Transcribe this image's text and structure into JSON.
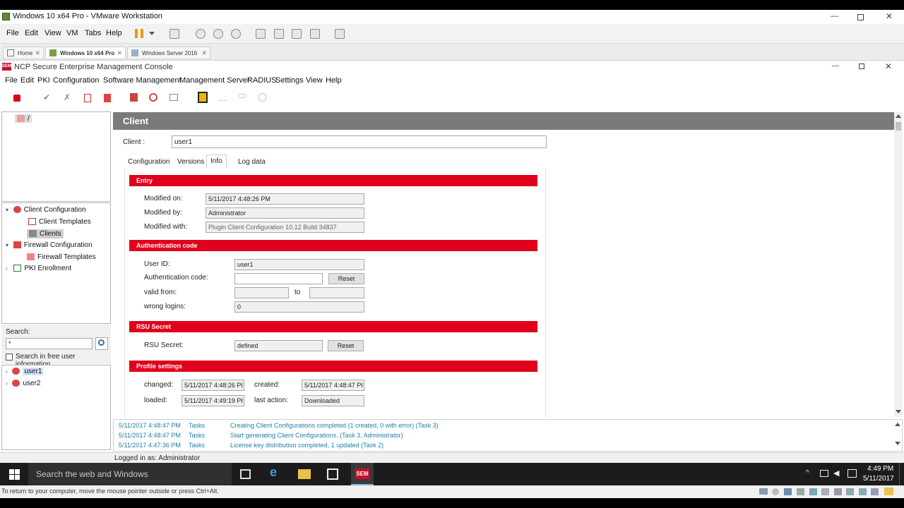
{
  "vmware": {
    "title": "Windows 10 x64 Pro - VMware Workstation",
    "menu": [
      "File",
      "Edit",
      "View",
      "VM",
      "Tabs",
      "Help"
    ],
    "tabs": [
      {
        "label": "Home"
      },
      {
        "label": "Windows 10 x64 Pro"
      },
      {
        "label": "Windows Server 2016"
      }
    ],
    "status_hint": "To return to your computer, move the mouse pointer outside or press Ctrl+Alt."
  },
  "app": {
    "badge": "SEM",
    "title": "NCP Secure Enterprise Management Console",
    "menu": [
      "File",
      "Edit",
      "PKI",
      "Configuration",
      "Software Management",
      "Management Server",
      "RADIUS",
      "Settings",
      "View",
      "Help"
    ],
    "root_node": "/",
    "tree": [
      {
        "label": "Client Configuration"
      },
      {
        "label": "Client Templates"
      },
      {
        "label": "Clients"
      },
      {
        "label": "Firewall Configuration"
      },
      {
        "label": "Firewall Templates"
      },
      {
        "label": "PKI Enrollment"
      }
    ],
    "search": {
      "label": "Search:",
      "value": "*",
      "free_user_info_label": "Search in free user information"
    },
    "users": [
      "user1",
      "user2"
    ],
    "status": "Logged in as: Administrator"
  },
  "client_panel": {
    "header": "Client",
    "client_label": "Client :",
    "client_value": "user1",
    "tabs": [
      "Configuration",
      "Versions",
      "Info",
      "Log data"
    ],
    "entry": {
      "title": "Entry",
      "modified_on_label": "Modified on:",
      "modified_on": "5/11/2017 4:48:26 PM",
      "modified_by_label": "Modified by:",
      "modified_by": "Administrator",
      "modified_with_label": "Modified with:",
      "modified_with": "Plugin Client Configuration 10.12 Build 34837"
    },
    "auth": {
      "title": "Authentication code",
      "user_id_label": "User ID:",
      "user_id": "user1",
      "auth_code_label": "Authentication code:",
      "auth_code": "",
      "reset_label": "Reset",
      "valid_from_label": "valid from:",
      "to_label": "to",
      "wrong_logins_label": "wrong logins:",
      "wrong_logins": "0"
    },
    "rsu": {
      "title": "RSU Secret",
      "label": "RSU Secret:",
      "value": "defined",
      "reset_label": "Reset"
    },
    "profile": {
      "title": "Profile settings",
      "changed_label": "changed:",
      "changed": "5/11/2017 4:48:26 PI",
      "created_label": "created:",
      "created": "5/11/2017 4:48:47 PI",
      "loaded_label": "loaded:",
      "loaded": "5/11/2017 4:49:19 PI",
      "last_action_label": "last action:",
      "last_action": "Downloaded"
    }
  },
  "log": [
    {
      "time": "5/11/2017 4:48:47 PM",
      "source": "Tasks",
      "message": "Creating Client Configurations completed (1 created, 0 with error) (Task 3)"
    },
    {
      "time": "5/11/2017 4:48:47 PM",
      "source": "Tasks",
      "message": "Start generating Client Configurations. (Task 3, Administrator)"
    },
    {
      "time": "5/11/2017 4:47:36 PM",
      "source": "Tasks",
      "message": "License key distribution completed, 1 updated (Task 2)"
    }
  ],
  "taskbar": {
    "search_placeholder": "Search the web and Windows",
    "sem_label": "SEM",
    "time": "4:49 PM",
    "date": "5/11/2017"
  },
  "colors": {
    "accent_red": "#e0001b",
    "header_gray": "#7a7a7a",
    "log_blue": "#1e7fa8"
  }
}
